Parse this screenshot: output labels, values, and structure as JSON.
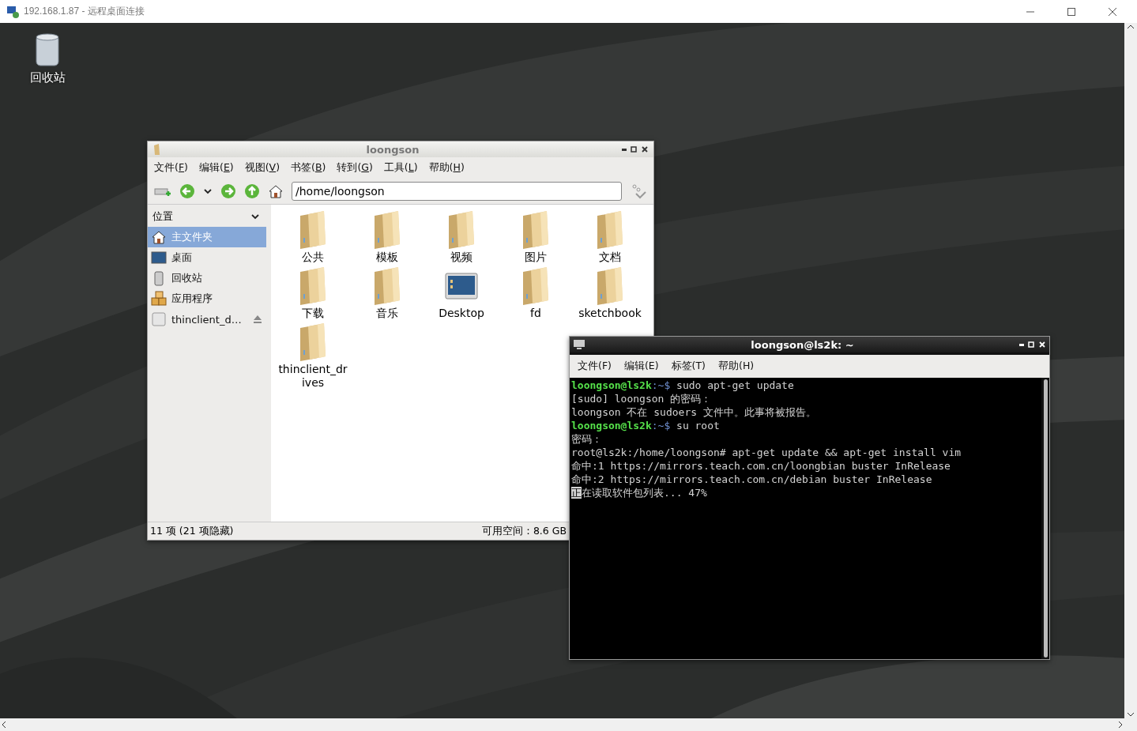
{
  "rdp_window": {
    "title": "192.168.1.87 - 远程桌面连接"
  },
  "desktop_icons": [
    {
      "label": "回收站",
      "kind": "trash"
    }
  ],
  "file_manager": {
    "title": "loongson",
    "menu": [
      {
        "before": "文件(",
        "key": "F",
        "after": ")"
      },
      {
        "before": "编辑(",
        "key": "E",
        "after": ")"
      },
      {
        "before": "视图(",
        "key": "V",
        "after": ")"
      },
      {
        "before": "书签(",
        "key": "B",
        "after": ")"
      },
      {
        "before": "转到(",
        "key": "G",
        "after": ")"
      },
      {
        "before": "工具(",
        "key": "L",
        "after": ")"
      },
      {
        "before": "帮助(",
        "key": "H",
        "after": ")"
      }
    ],
    "location": "/home/loongson",
    "places_heading": "位置",
    "places": [
      {
        "label": "主文件夹",
        "kind": "home",
        "selected": true
      },
      {
        "label": "桌面",
        "kind": "desktop",
        "selected": false
      },
      {
        "label": "回收站",
        "kind": "trash",
        "selected": false
      },
      {
        "label": "应用程序",
        "kind": "apps",
        "selected": false
      },
      {
        "label": "thinclient_d…",
        "kind": "drive",
        "selected": false
      }
    ],
    "items": [
      {
        "label": "公共",
        "kind": "folder"
      },
      {
        "label": "模板",
        "kind": "folder"
      },
      {
        "label": "视频",
        "kind": "folder"
      },
      {
        "label": "图片",
        "kind": "folder"
      },
      {
        "label": "文档",
        "kind": "folder"
      },
      {
        "label": "下载",
        "kind": "folder"
      },
      {
        "label": "音乐",
        "kind": "folder"
      },
      {
        "label": "Desktop",
        "kind": "desktop"
      },
      {
        "label": "fd",
        "kind": "folder"
      },
      {
        "label": "sketchbook",
        "kind": "folder"
      },
      {
        "label": "thinclient_drives",
        "kind": "folder"
      }
    ],
    "status": {
      "count": "11 项 (21 项隐藏)",
      "free_space": "可用空间：8.6 GB"
    }
  },
  "terminal": {
    "title": "loongson@ls2k: ~",
    "menu": [
      "文件(F)",
      "编辑(E)",
      "标签(T)",
      "帮助(H)"
    ],
    "lines": [
      {
        "kind": "prompt",
        "user": "loongson@ls2k",
        "path": ":~$",
        "text": " sudo apt-get update"
      },
      {
        "kind": "output",
        "text": "[sudo] loongson 的密码："
      },
      {
        "kind": "output",
        "text": "loongson 不在 sudoers 文件中。此事将被报告。"
      },
      {
        "kind": "prompt",
        "user": "loongson@ls2k",
        "path": ":~$",
        "text": " su root"
      },
      {
        "kind": "output",
        "text": "密码："
      },
      {
        "kind": "output",
        "text": "root@ls2k:/home/loongson# apt-get update && apt-get install vim"
      },
      {
        "kind": "output",
        "text": "命中:1 https://mirrors.teach.com.cn/loongbian buster InRelease"
      },
      {
        "kind": "output",
        "text": "命中:2 https://mirrors.teach.com.cn/debian buster InRelease"
      },
      {
        "kind": "cursor",
        "cursor": "正",
        "text": "在读取软件包列表... 47%"
      }
    ]
  }
}
